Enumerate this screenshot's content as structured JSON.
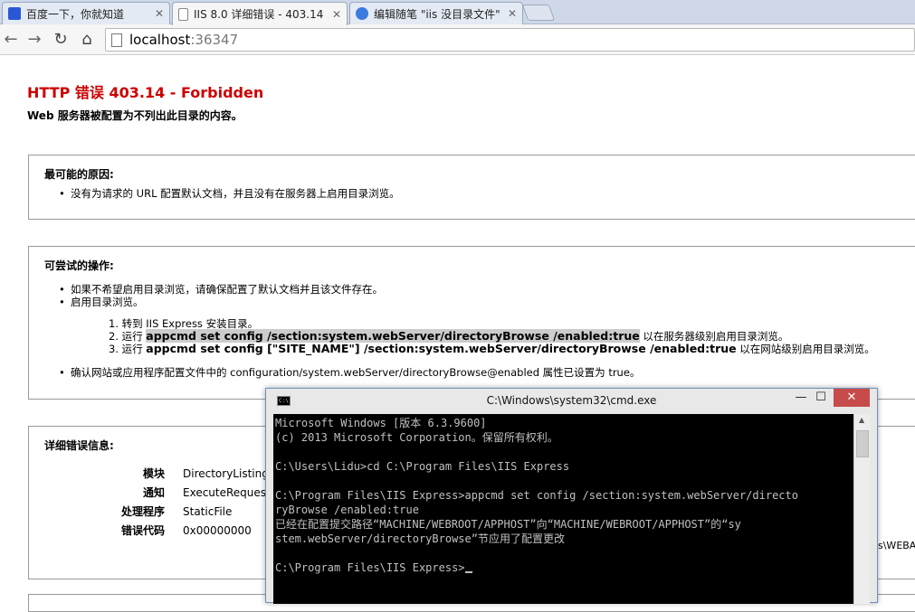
{
  "tabs": [
    {
      "title": "百度一下，你就知道",
      "favicon_color": "#2b57d6"
    },
    {
      "title": "IIS 8.0 详细错误 - 403.14",
      "favicon_color": "#ffffff"
    },
    {
      "title": "编辑随笔 \"iis 没目录文件\"",
      "favicon_color": "#3b7be0"
    }
  ],
  "address": {
    "host": "localhost",
    "port": ":36347"
  },
  "page": {
    "title": "HTTP 错误 403.14 - Forbidden",
    "subtitle": "Web 服务器被配置为不列出此目录的内容。",
    "cause": {
      "heading": "最可能的原因:",
      "items": [
        "没有为请求的 URL 配置默认文档，并且没有在服务器上启用目录浏览。"
      ]
    },
    "actions": {
      "heading": "可尝试的操作:",
      "item1": "如果不希望启用目录浏览，请确保配置了默认文档并且该文件存在。",
      "item2": "启用目录浏览。",
      "step1": "1. 转到 IIS Express 安装目录。",
      "step2_pre": "2. 运行 ",
      "step2_code": "appcmd set config /section:system.webServer/directoryBrowse /enabled:true",
      "step2_post": " 以在服务器级别启用目录浏览。",
      "step3_pre": "3. 运行 ",
      "step3_code": "appcmd set config [\"SITE_NAME\"] /section:system.webServer/directoryBrowse /enabled:true",
      "step3_post": " 以在网站级别启用目录浏览。",
      "item3": "确认网站或应用程序配置文件中的 configuration/system.webServer/directoryBrowse@enabled 属性已设置为 true。"
    },
    "details": {
      "heading": "详细错误信息:",
      "rows": [
        {
          "key": "模块",
          "value": "DirectoryListingM"
        },
        {
          "key": "通知",
          "value": "ExecuteRequestH"
        },
        {
          "key": "处理程序",
          "value": "StaticFile"
        },
        {
          "key": "错误代码",
          "value": "0x00000000"
        }
      ],
      "clipped_right": "s\\WEBA"
    }
  },
  "cmd": {
    "title": "C:\\Windows\\system32\\cmd.exe",
    "icon_label": "C:\\",
    "lines": "Microsoft Windows [版本 6.3.9600]\n(c) 2013 Microsoft Corporation。保留所有权利。\n\nC:\\Users\\Lidu>cd C:\\Program Files\\IIS Express\n\nC:\\Program Files\\IIS Express>appcmd set config /section:system.webServer/directo\nryBrowse /enabled:true\n已经在配置提交路径“MACHINE/WEBROOT/APPHOST”向“MACHINE/WEBROOT/APPHOST”的“sy\nstem.webServer/directoryBrowse”节应用了配置更改\n\nC:\\Program Files\\IIS Express>"
  }
}
